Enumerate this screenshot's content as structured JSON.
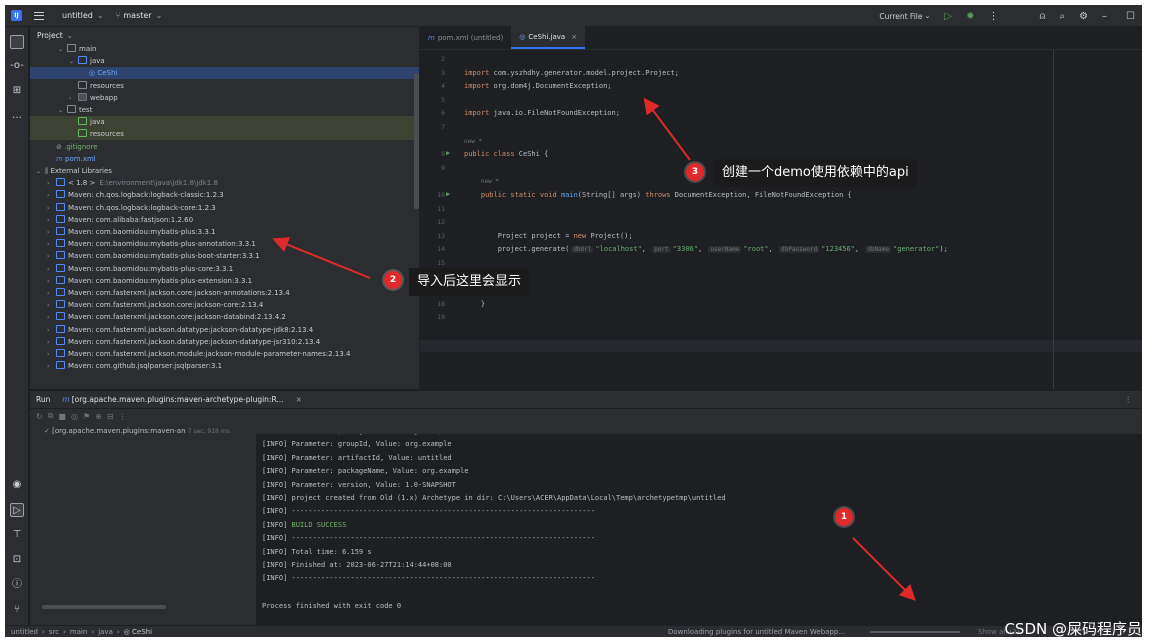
{
  "titlebar": {
    "project": "untitled",
    "branch": "master",
    "run_config": "Current File"
  },
  "project_panel": {
    "title": "Project",
    "tree": [
      {
        "label": "main",
        "indent": 2,
        "arrow": "v",
        "icon": "folder",
        "style": ""
      },
      {
        "label": "java",
        "indent": 3,
        "arrow": "v",
        "icon": "folder-blue",
        "style": ""
      },
      {
        "label": "CeShi",
        "indent": 4,
        "arrow": "",
        "icon": "class",
        "style": "sel"
      },
      {
        "label": "resources",
        "indent": 3,
        "arrow": "",
        "icon": "folder",
        "style": ""
      },
      {
        "label": "webapp",
        "indent": 3,
        "arrow": ">",
        "icon": "folder-dark",
        "style": ""
      },
      {
        "label": "test",
        "indent": 2,
        "arrow": "v",
        "icon": "folder",
        "style": ""
      },
      {
        "label": "java",
        "indent": 3,
        "arrow": "",
        "icon": "folder-green",
        "style": "hl"
      },
      {
        "label": "resources",
        "indent": 3,
        "arrow": "",
        "icon": "folder-green",
        "style": "hl"
      },
      {
        "label": ".gitignore",
        "indent": 1,
        "arrow": "",
        "icon": "gitignore",
        "style": "green"
      },
      {
        "label": "pom.xml",
        "indent": 1,
        "arrow": "",
        "icon": "maven",
        "style": "blue"
      },
      {
        "label": "External Libraries",
        "indent": 0,
        "arrow": "v",
        "icon": "libs",
        "style": ""
      },
      {
        "label": "< 1.8 >",
        "extra": "E:\\environment\\java\\jdk1.8\\jdk1.8",
        "indent": 1,
        "arrow": ">",
        "icon": "lib",
        "style": ""
      },
      {
        "label": "Maven: ch.qos.logback:logback-classic:1.2.3",
        "indent": 1,
        "arrow": ">",
        "icon": "lib",
        "style": ""
      },
      {
        "label": "Maven: ch.qos.logback:logback-core:1.2.3",
        "indent": 1,
        "arrow": ">",
        "icon": "lib",
        "style": ""
      },
      {
        "label": "Maven: com.alibaba:fastjson:1.2.60",
        "indent": 1,
        "arrow": ">",
        "icon": "lib",
        "style": ""
      },
      {
        "label": "Maven: com.baomidou:mybatis-plus:3.3.1",
        "indent": 1,
        "arrow": ">",
        "icon": "lib",
        "style": ""
      },
      {
        "label": "Maven: com.baomidou:mybatis-plus-annotation:3.3.1",
        "indent": 1,
        "arrow": ">",
        "icon": "lib",
        "style": ""
      },
      {
        "label": "Maven: com.baomidou:mybatis-plus-boot-starter:3.3.1",
        "indent": 1,
        "arrow": ">",
        "icon": "lib",
        "style": ""
      },
      {
        "label": "Maven: com.baomidou:mybatis-plus-core:3.3.1",
        "indent": 1,
        "arrow": ">",
        "icon": "lib",
        "style": ""
      },
      {
        "label": "Maven: com.baomidou:mybatis-plus-extension:3.3.1",
        "indent": 1,
        "arrow": ">",
        "icon": "lib",
        "style": ""
      },
      {
        "label": "Maven: com.fasterxml.jackson.core:jackson-annotations:2.13.4",
        "indent": 1,
        "arrow": ">",
        "icon": "lib",
        "style": ""
      },
      {
        "label": "Maven: com.fasterxml.jackson.core:jackson-core:2.13.4",
        "indent": 1,
        "arrow": ">",
        "icon": "lib",
        "style": ""
      },
      {
        "label": "Maven: com.fasterxml.jackson.core:jackson-databind:2.13.4.2",
        "indent": 1,
        "arrow": ">",
        "icon": "lib",
        "style": ""
      },
      {
        "label": "Maven: com.fasterxml.jackson.datatype:jackson-datatype-jdk8:2.13.4",
        "indent": 1,
        "arrow": ">",
        "icon": "lib",
        "style": ""
      },
      {
        "label": "Maven: com.fasterxml.jackson.datatype:jackson-datatype-jsr310:2.13.4",
        "indent": 1,
        "arrow": ">",
        "icon": "lib",
        "style": ""
      },
      {
        "label": "Maven: com.fasterxml.jackson.module:jackson-module-parameter-names:2.13.4",
        "indent": 1,
        "arrow": ">",
        "icon": "lib",
        "style": ""
      },
      {
        "label": "Maven: com.github.jsqlparser:jsqlparser:3.1",
        "indent": 1,
        "arrow": ">",
        "icon": "lib",
        "style": ""
      }
    ]
  },
  "editor": {
    "tabs": [
      {
        "label": "pom.xml (untitled)",
        "icon": "maven-icon",
        "active": false
      },
      {
        "label": "CeShi.java",
        "icon": "class-icon",
        "active": true
      }
    ],
    "lines": [
      {
        "n": "2",
        "html": ""
      },
      {
        "n": "3",
        "html": "<span class='kw'>import</span> com.yszhdhy.generator.model.project.Project;"
      },
      {
        "n": "4",
        "html": "<span class='kw'>import</span> org.dom4j.DocumentException;"
      },
      {
        "n": "5",
        "html": ""
      },
      {
        "n": "6",
        "html": "<span class='kw'>import</span> java.io.FileNotFoundException;"
      },
      {
        "n": "7",
        "html": ""
      },
      {
        "n": "",
        "html": "<span style='color:#6f737a;font-size:6px'>new *</span>"
      },
      {
        "n": "8",
        "html": "<span class='kw'>public class</span> CeShi {",
        "run": true
      },
      {
        "n": "9",
        "html": ""
      },
      {
        "n": "",
        "html": "    <span style='color:#6f737a;font-size:6px'>new *</span>"
      },
      {
        "n": "10",
        "html": "    <span class='kw'>public static void</span> <span class='fn'>main</span>(String[] args) <span class='kw'>throws</span> DocumentException, FileNotFoundException {",
        "run": true
      },
      {
        "n": "11",
        "html": ""
      },
      {
        "n": "12",
        "html": ""
      },
      {
        "n": "13",
        "html": "        Project project = <span class='kw'>new</span> Project();"
      },
      {
        "n": "14",
        "html": "        project.generate(<span class='hint'>dbUrl</span><span class='st'>\"localhost\"</span>, <span class='hint'>port</span><span class='st'>\"3306\"</span>, <span class='hint'>userName</span><span class='st'>\"root\"</span>, <span class='hint'>dbPassword</span><span class='st'>\"123456\"</span>, <span class='hint'>dbName</span><span class='st'>\"generator\"</span>);"
      },
      {
        "n": "15",
        "html": ""
      },
      {
        "n": "16",
        "html": ""
      },
      {
        "n": "17",
        "html": ""
      },
      {
        "n": "18",
        "html": "    }"
      },
      {
        "n": "19",
        "html": ""
      }
    ]
  },
  "run_panel": {
    "tab_run": "Run",
    "tab_config": "[org.apache.maven.plugins:maven-archetype-plugin:R...",
    "tree_item": "[org.apache.maven.plugins:maven-an",
    "tree_time": "7 sec, 918 ms",
    "console": [
      {
        "text": "[INFO] Parameter: package, Value: org.example",
        "cls": ""
      },
      {
        "text": "[INFO] Parameter: groupId, Value: org.example",
        "cls": ""
      },
      {
        "text": "[INFO] Parameter: artifactId, Value: untitled",
        "cls": ""
      },
      {
        "text": "[INFO] Parameter: packageName, Value: org.example",
        "cls": ""
      },
      {
        "text": "[INFO] Parameter: version, Value: 1.0-SNAPSHOT",
        "cls": ""
      },
      {
        "text": "[INFO] project created from Old (1.x) Archetype in dir: C:\\Users\\ACER\\AppData\\Local\\Temp\\archetypetmp\\untitled",
        "cls": ""
      },
      {
        "text": "[INFO] ------------------------------------------------------------------------",
        "cls": ""
      },
      {
        "text": "[INFO] BUILD SUCCESS",
        "cls": "success"
      },
      {
        "text": "[INFO] ------------------------------------------------------------------------",
        "cls": ""
      },
      {
        "text": "[INFO] Total time:  6.159 s",
        "cls": ""
      },
      {
        "text": "[INFO] Finished at: 2023-06-27T21:14:44+08:00",
        "cls": ""
      },
      {
        "text": "[INFO] ------------------------------------------------------------------------",
        "cls": ""
      },
      {
        "text": "",
        "cls": ""
      },
      {
        "text": "Process finished with exit code 0",
        "cls": ""
      }
    ]
  },
  "statusbar": {
    "crumbs": [
      "untitled",
      "src",
      "main",
      "java",
      "CeShi"
    ],
    "progress_text": "Downloading plugins for untitled Maven Webapp...",
    "extra": "Show all (2)"
  },
  "annotations": {
    "a1": {
      "num": "1"
    },
    "a2": {
      "num": "2",
      "text": "导入后这里会显示"
    },
    "a3": {
      "num": "3",
      "text": "创建一个demo使用依赖中的api"
    }
  },
  "watermark": "CSDN @屎码程序员",
  "colors": {
    "accent": "#3574f0",
    "badge": "#e02a2a",
    "success": "#73b56c"
  }
}
